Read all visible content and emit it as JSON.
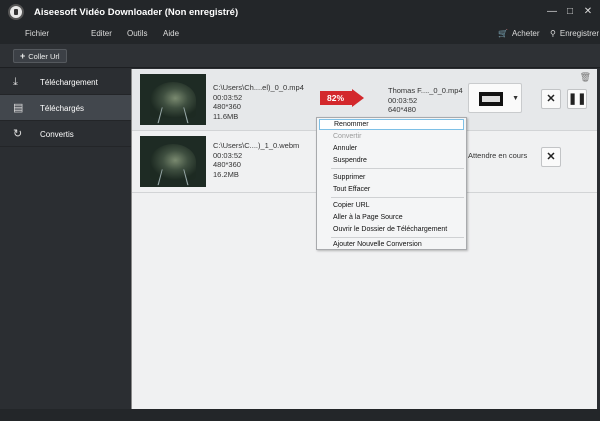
{
  "app": {
    "title": "Aiseesoft Vidéo Downloader (Non enregistré)"
  },
  "menu": {
    "items": [
      "Fichier",
      "Editer",
      "Outils",
      "Aide"
    ],
    "buy": "Acheter",
    "register": "Enregistrer"
  },
  "toolbar": {
    "paste_url": "Coller Url"
  },
  "sidebar": {
    "items": [
      {
        "label": "Téléchargement",
        "icon": "download-icon"
      },
      {
        "label": "Téléchargés",
        "icon": "downloaded-icon"
      },
      {
        "label": "Convertis",
        "icon": "convert-icon"
      }
    ]
  },
  "rows": [
    {
      "path": "C:\\Users\\Ch....el)_0_0.mp4",
      "duration": "00:03:52",
      "resolution": "480*360",
      "size": "11.6MB",
      "progress": "82%",
      "output_name": "Thomas F...._0_0.mp4",
      "output_duration": "00:03:52",
      "output_resolution": "640*480"
    },
    {
      "path": "C:\\Users\\C....)_1_0.webm",
      "duration": "00:03:52",
      "resolution": "480*360",
      "size": "16.2MB",
      "status": "Attendre en cours"
    }
  ],
  "context_menu": {
    "items": [
      {
        "label": "Renommer",
        "state": "hover"
      },
      {
        "label": "Convertir",
        "state": "disabled"
      },
      {
        "label": "Annuler"
      },
      {
        "label": "Suspendre"
      },
      {
        "label": "Supprimer"
      },
      {
        "label": "Tout Effacer"
      },
      {
        "label": "Copier URL"
      },
      {
        "label": "Aller à la Page Source"
      },
      {
        "label": "Ouvrir le Dossier de Téléchargement"
      },
      {
        "label": "Ajouter Nouvelle Conversion"
      }
    ]
  },
  "colors": {
    "progress_badge": "#d3282c",
    "hover_border": "#7ec0e6",
    "titlebar": "#232629"
  }
}
